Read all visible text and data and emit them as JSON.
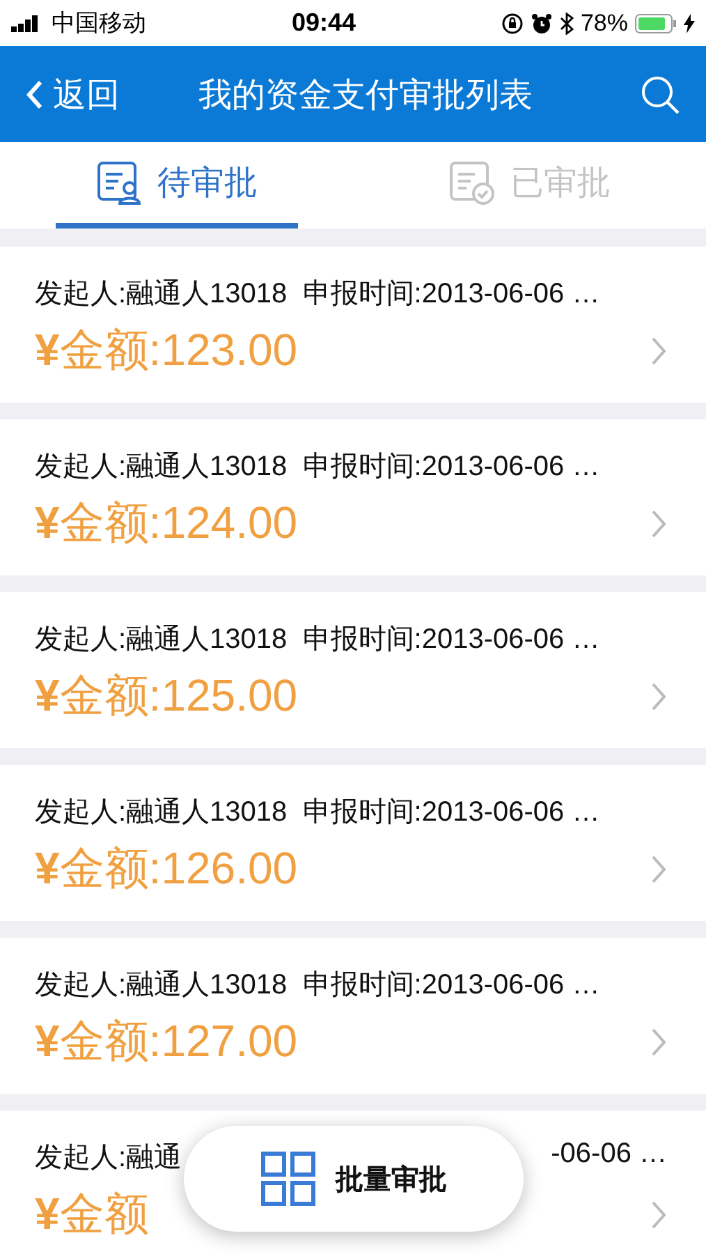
{
  "status_bar": {
    "carrier": "中国移动",
    "time": "09:44",
    "battery": "78%"
  },
  "nav": {
    "back": "返回",
    "title": "我的资金支付审批列表"
  },
  "tabs": [
    {
      "label": "待审批",
      "selected": true
    },
    {
      "label": "已审批",
      "selected": false
    }
  ],
  "items": [
    {
      "kind": "full",
      "info": "发起人:融通人13018  申报时间:2013-06-06 …",
      "amount": "**¥**金额:123.00"
    },
    {
      "kind": "full",
      "info": "发起人:融通人13018  申报时间:2013-06-06 …",
      "amount": "**¥**金额:124.00"
    },
    {
      "kind": "full",
      "info": "发起人:融通人13018  申报时间:2013-06-06 …",
      "amount": "**¥**金额:125.00"
    },
    {
      "kind": "full",
      "info": "发起人:融通人13018  申报时间:2013-06-06 …",
      "amount": "**¥**金额:126.00"
    },
    {
      "kind": "full",
      "info": "发起人:融通人13018  申报时间:2013-06-06 …",
      "amount": "**¥**金额:127.00"
    },
    {
      "kind": "covered",
      "info_start": "发起人:融通",
      "info_end": "-06-06 …",
      "amount": "**¥**金额"
    }
  ],
  "batch_button": {
    "label": "批量审批"
  }
}
